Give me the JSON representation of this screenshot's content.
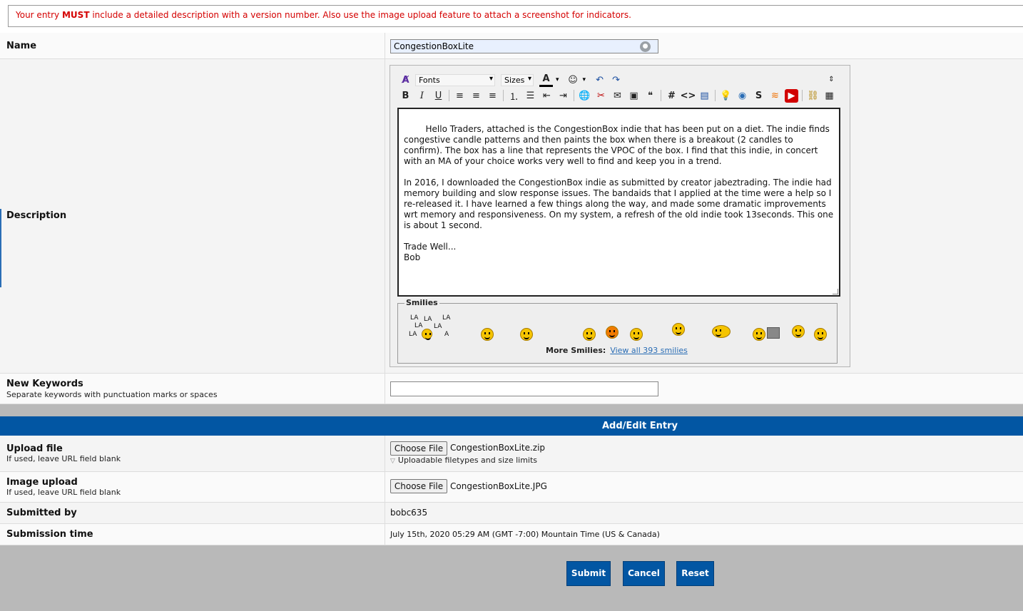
{
  "notice": {
    "pre": "Your entry ",
    "strong": "MUST",
    "post": " include a detailed description with a version number. Also use the image upload feature to attach a screenshot for indicators."
  },
  "name": {
    "label": "Name",
    "value": "CongestionBoxLite"
  },
  "description": {
    "label": "Description",
    "toolbar": {
      "fonts": "Fonts",
      "sizes": "Sizes"
    },
    "text": "Hello Traders, attached is the CongestionBox indie that has been put on a diet. The indie finds congestive candle patterns and then paints the box when there is a breakout (2 candles to confirm). The box has a line that represents the VPOC of the box. I find that this indie, in concert with an MA of your choice works very well to find and keep you in a trend.\n\nIn 2016, I downloaded the CongestionBox indie as submitted by creator jabeztrading. The indie had memory building and slow response issues. The bandaids that I applied at the time were a help so I re-released it. I have learned a few things along the way, and made some dramatic improvements wrt memory and responsiveness. On my system, a refresh of the old indie took 13seconds. This one is about 1 second.\n\nTrade Well...\nBob",
    "smilies_title": "Smilies",
    "lala": [
      "LA",
      "LA",
      "LA",
      "LA",
      "LA",
      "LA",
      "A"
    ],
    "more_smilies_label": "More Smilies:",
    "view_all_link": "View all 393 smilies"
  },
  "keywords": {
    "label": "New Keywords",
    "hint": "Separate keywords with punctuation marks or spaces",
    "value": ""
  },
  "section_title": "Add/Edit Entry",
  "upload_file": {
    "label": "Upload file",
    "hint": "If used, leave URL field blank",
    "button": "Choose File",
    "filename": "CongestionBoxLite.zip",
    "limits": "Uploadable filetypes and size limits"
  },
  "image_upload": {
    "label": "Image upload",
    "hint": "If used, leave URL field blank",
    "button": "Choose File",
    "filename": "CongestionBoxLite.JPG"
  },
  "submitted_by": {
    "label": "Submitted by",
    "value": "bobc635"
  },
  "submission_time": {
    "label": "Submission time",
    "value": "July 15th, 2020 05:29 AM (GMT -7:00) Mountain Time (US & Canada)"
  },
  "buttons": {
    "submit": "Submit",
    "cancel": "Cancel",
    "reset": "Reset"
  }
}
